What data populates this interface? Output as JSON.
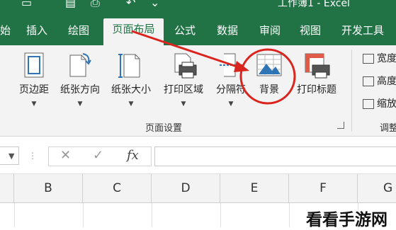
{
  "titlebar": {
    "title": "工作簿1 - Excel"
  },
  "tabs": [
    {
      "label": "始"
    },
    {
      "label": "插入"
    },
    {
      "label": "绘图"
    },
    {
      "label": "页面布局"
    },
    {
      "label": "公式"
    },
    {
      "label": "数据"
    },
    {
      "label": "审阅"
    },
    {
      "label": "视图"
    },
    {
      "label": "开发工具"
    }
  ],
  "active_tab": "页面布局",
  "ribbon": {
    "buttons": [
      {
        "label": "页边距"
      },
      {
        "label": "纸张方向"
      },
      {
        "label": "纸张大小"
      },
      {
        "label": "打印区域"
      },
      {
        "label": "分隔符"
      },
      {
        "label": "背景"
      },
      {
        "label": "打印标题"
      }
    ],
    "group_label": "页面设置",
    "side": [
      {
        "label": "宽度"
      },
      {
        "label": "高度"
      },
      {
        "label": "缩放"
      }
    ],
    "adjust_label": "调整"
  },
  "formula_bar": {
    "cancel": "✕",
    "enter": "✓",
    "fx": "fx",
    "value": ""
  },
  "columns": [
    "B",
    "C",
    "D",
    "E",
    "F",
    "G"
  ],
  "watermark": "看看手游网",
  "colors": {
    "accent": "#217346",
    "annotation": "#d9251d"
  }
}
